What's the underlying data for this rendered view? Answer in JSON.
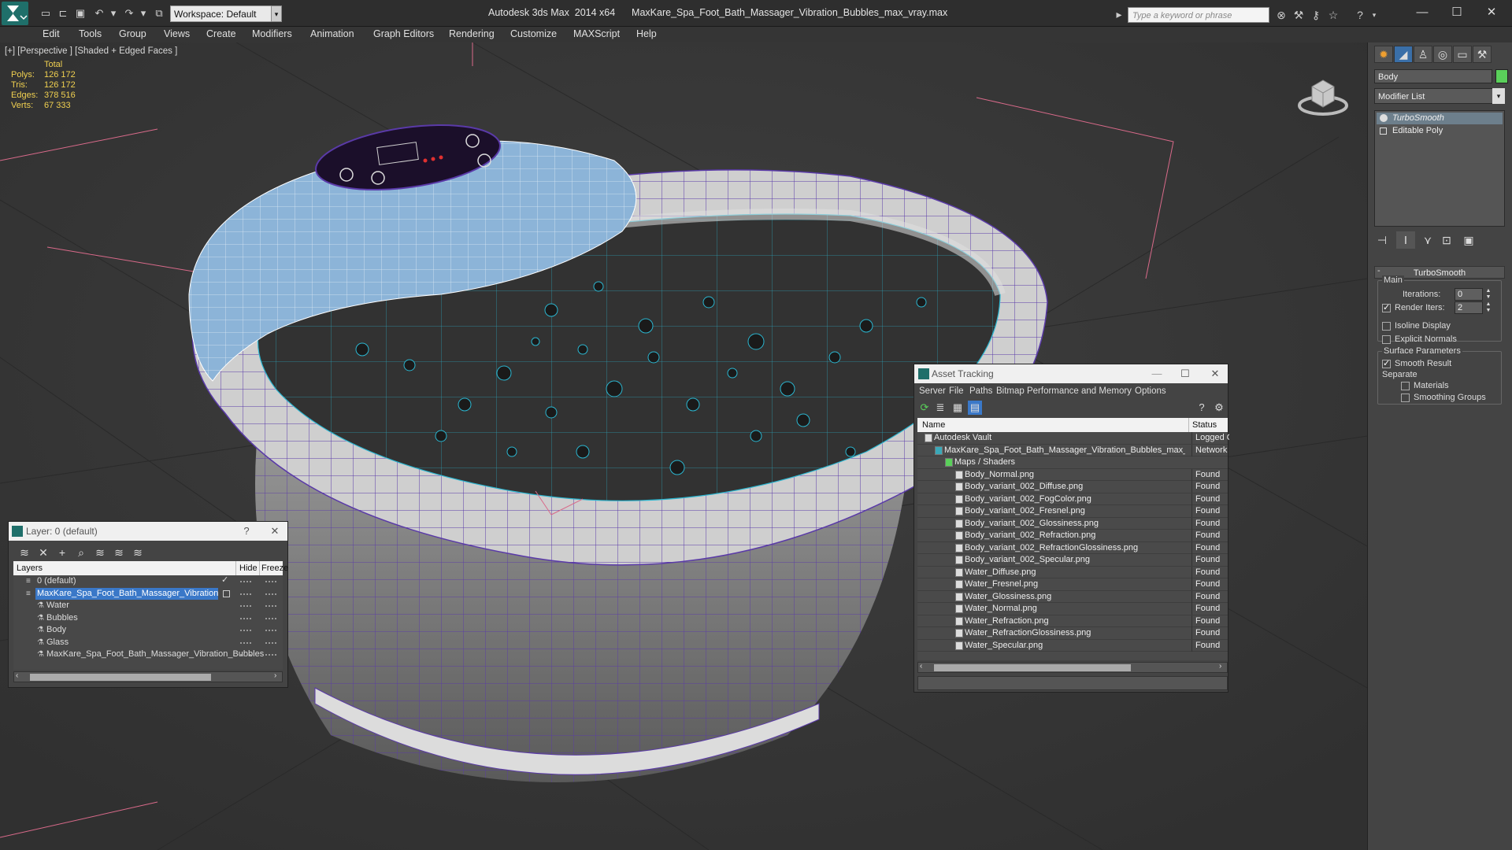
{
  "titlebar": {
    "workspace": "Workspace: Default",
    "title": "Autodesk 3ds Max  2014 x64      MaxKare_Spa_Foot_Bath_Massager_Vibration_Bubbles_max_vray.max",
    "search_placeholder": "Type a keyword or phrase"
  },
  "menu": [
    "Edit",
    "Tools",
    "Group",
    "Views",
    "Create",
    "Modifiers",
    "Animation",
    "Graph Editors",
    "Rendering",
    "Customize",
    "MAXScript",
    "Help"
  ],
  "viewport": {
    "label": "[+] [Perspective ] [Shaded + Edged Faces ]",
    "stats": {
      "header": "Total",
      "rows": [
        {
          "label": "Polys:",
          "value": "126 172"
        },
        {
          "label": "Tris:",
          "value": "126 172"
        },
        {
          "label": "Edges:",
          "value": "378 516"
        },
        {
          "label": "Verts:",
          "value": "67 333"
        }
      ]
    }
  },
  "command_panel": {
    "object_name": "Body",
    "object_color": "#5ad05a",
    "modifier_list": "Modifier List",
    "stack": [
      "TurboSmooth",
      "Editable Poly"
    ],
    "rollout": "TurboSmooth",
    "main_group": "Main",
    "iterations_label": "Iterations:",
    "iterations_value": "0",
    "render_iters_label": "Render Iters:",
    "render_iters_value": "2",
    "isoline_display": "Isoline Display",
    "explicit_normals": "Explicit Normals",
    "surface_parameters": "Surface Parameters",
    "smooth_result": "Smooth Result",
    "separate": "Separate",
    "materials": "Materials",
    "smoothing_groups": "Smoothing Groups"
  },
  "layer_window": {
    "title": "Layer: 0 (default)",
    "col_layers": "Layers",
    "col_hide": "Hide",
    "col_freeze": "Freeze",
    "rows": [
      {
        "name": "0 (default)",
        "indent": 0,
        "selected": false
      },
      {
        "name": "MaxKare_Spa_Foot_Bath_Massager_Vibration_Bubbles",
        "indent": 0,
        "selected": true
      },
      {
        "name": "Water",
        "indent": 1,
        "selected": false
      },
      {
        "name": "Bubbles",
        "indent": 1,
        "selected": false
      },
      {
        "name": "Body",
        "indent": 1,
        "selected": false
      },
      {
        "name": "Glass",
        "indent": 1,
        "selected": false
      },
      {
        "name": "MaxKare_Spa_Foot_Bath_Massager_Vibration_Bubbles",
        "indent": 1,
        "selected": false
      }
    ]
  },
  "asset_tracking": {
    "title": "Asset Tracking",
    "menu": [
      "Server",
      "File",
      "Paths",
      "Bitmap Performance and Memory",
      "Options"
    ],
    "col_name": "Name",
    "col_status": "Status",
    "rows": [
      {
        "name": "Autodesk Vault",
        "status": "Logged Out",
        "indent": 1
      },
      {
        "name": "MaxKare_Spa_Foot_Bath_Massager_Vibration_Bubbles_max_vray.max",
        "status": "Network Path",
        "indent": 2
      },
      {
        "name": "Maps / Shaders",
        "status": "",
        "indent": 3
      },
      {
        "name": "Body_Normal.png",
        "status": "Found",
        "indent": 4
      },
      {
        "name": "Body_variant_002_Diffuse.png",
        "status": "Found",
        "indent": 4
      },
      {
        "name": "Body_variant_002_FogColor.png",
        "status": "Found",
        "indent": 4
      },
      {
        "name": "Body_variant_002_Fresnel.png",
        "status": "Found",
        "indent": 4
      },
      {
        "name": "Body_variant_002_Glossiness.png",
        "status": "Found",
        "indent": 4
      },
      {
        "name": "Body_variant_002_Refraction.png",
        "status": "Found",
        "indent": 4
      },
      {
        "name": "Body_variant_002_RefractionGlossiness.png",
        "status": "Found",
        "indent": 4
      },
      {
        "name": "Body_variant_002_Specular.png",
        "status": "Found",
        "indent": 4
      },
      {
        "name": "Water_Diffuse.png",
        "status": "Found",
        "indent": 4
      },
      {
        "name": "Water_Fresnel.png",
        "status": "Found",
        "indent": 4
      },
      {
        "name": "Water_Glossiness.png",
        "status": "Found",
        "indent": 4
      },
      {
        "name": "Water_Normal.png",
        "status": "Found",
        "indent": 4
      },
      {
        "name": "Water_Refraction.png",
        "status": "Found",
        "indent": 4
      },
      {
        "name": "Water_RefractionGlossiness.png",
        "status": "Found",
        "indent": 4
      },
      {
        "name": "Water_Specular.png",
        "status": "Found",
        "indent": 4
      }
    ]
  }
}
